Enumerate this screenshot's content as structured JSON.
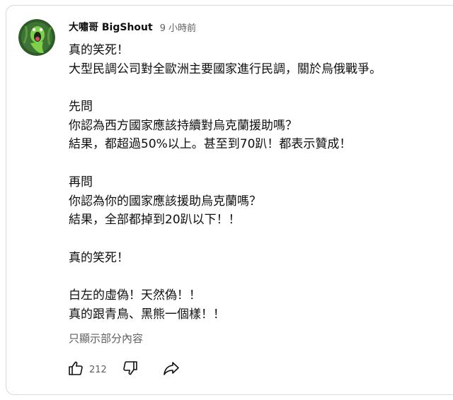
{
  "comment": {
    "author": "大嘯哥 BigShout",
    "time": "9 小時前",
    "lines": [
      "真的笑死！",
      "大型民調公司對全歐洲主要國家進行民調，關於烏俄戰爭。",
      "",
      "先問",
      "你認為西方國家應該持續對烏克蘭援助嗎？",
      "結果，都超過50%以上。甚至到70趴！都表示贊成！",
      "",
      "再問",
      "你認為你的國家應該援助烏克蘭嗎？",
      "結果，全部都掉到20趴以下！！",
      "",
      "真的笑死！",
      "",
      "白左的虛偽！天然偽！！",
      "真的跟青鳥、黑熊一個樣！！"
    ],
    "show_more_label": "只顯示部分內容",
    "like_count": "212"
  },
  "icons": {
    "like": "thumbs-up-icon",
    "dislike": "thumbs-down-icon",
    "share": "share-arrow-icon"
  },
  "colors": {
    "avatar_bg": "#2f5a2a",
    "avatar_figure": "#7fd14a",
    "secondary_text": "#606060",
    "primary_text": "#0f0f0f"
  }
}
